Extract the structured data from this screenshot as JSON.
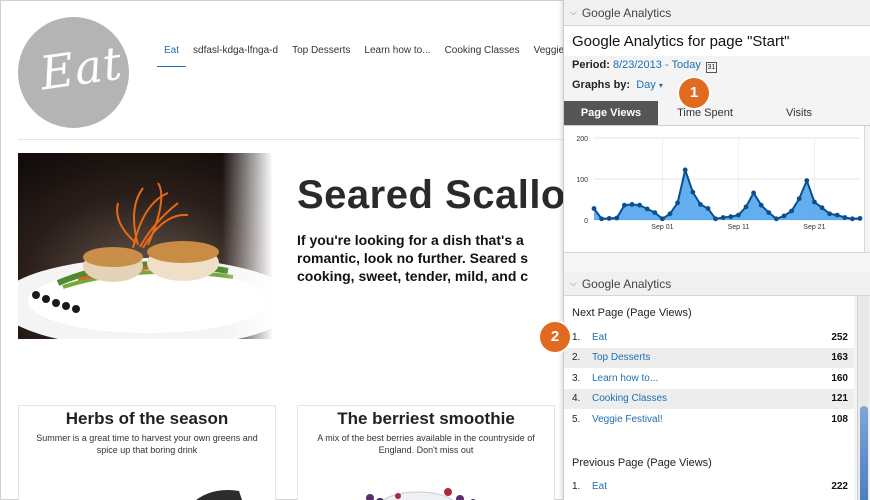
{
  "site": {
    "logo_text": "Eat",
    "nav": [
      "Eat",
      "sdfasl-kdga-lfnga-d",
      "Top Desserts",
      "Learn how to...",
      "Cooking Classes",
      "Veggie Festival!"
    ],
    "hero_title": "Seared Scallops",
    "hero_text": [
      "If you're looking for a dish that's a",
      "romantic, look no further. Seared s",
      "cooking, sweet, tender, mild, and c"
    ],
    "cards": [
      {
        "title": "Herbs of the season",
        "text": "Summer is a great time to harvest your own greens and spice up that boring drink"
      },
      {
        "title": "The berriest smoothie",
        "text": "A mix of the best berries available in the countryside of England. Don't miss out"
      }
    ]
  },
  "panel": {
    "section1_header": "Google Analytics",
    "title": "Google Analytics for page \"Start\"",
    "period_label": "Period:",
    "period_value": "8/23/2013 - Today",
    "graphs_by_label": "Graphs by:",
    "graphs_by_value": "Day",
    "badge1": "1",
    "badge2": "2",
    "tabs": [
      "Page Views",
      "Time Spent",
      "Visits"
    ],
    "section2_header": "Google Analytics",
    "next_page_title": "Next Page (Page Views)",
    "next_pages": [
      {
        "rank": "1.",
        "label": "Eat",
        "value": "252"
      },
      {
        "rank": "2.",
        "label": "Top Desserts",
        "value": "163"
      },
      {
        "rank": "3.",
        "label": "Learn how to...",
        "value": "160"
      },
      {
        "rank": "4.",
        "label": "Cooking Classes",
        "value": "121"
      },
      {
        "rank": "5.",
        "label": "Veggie Festival!",
        "value": "108"
      }
    ],
    "prev_page_title": "Previous Page (Page Views)",
    "prev_pages": [
      {
        "rank": "1.",
        "label": "Eat",
        "value": "222"
      }
    ]
  },
  "chart_data": {
    "type": "area",
    "yticks": [
      "200",
      "100",
      "0"
    ],
    "ylim": [
      0,
      200
    ],
    "xtick_labels": [
      "Sep 01",
      "Sep 11",
      "Sep 21"
    ],
    "xtick_index": [
      9,
      19,
      29
    ],
    "values": [
      28,
      3,
      4,
      5,
      36,
      38,
      36,
      27,
      18,
      3,
      15,
      42,
      122,
      68,
      38,
      28,
      3,
      6,
      8,
      12,
      32,
      66,
      36,
      18,
      3,
      10,
      22,
      52,
      96,
      44,
      30,
      15,
      12,
      6,
      3,
      4
    ],
    "color": "#2f93e8"
  }
}
